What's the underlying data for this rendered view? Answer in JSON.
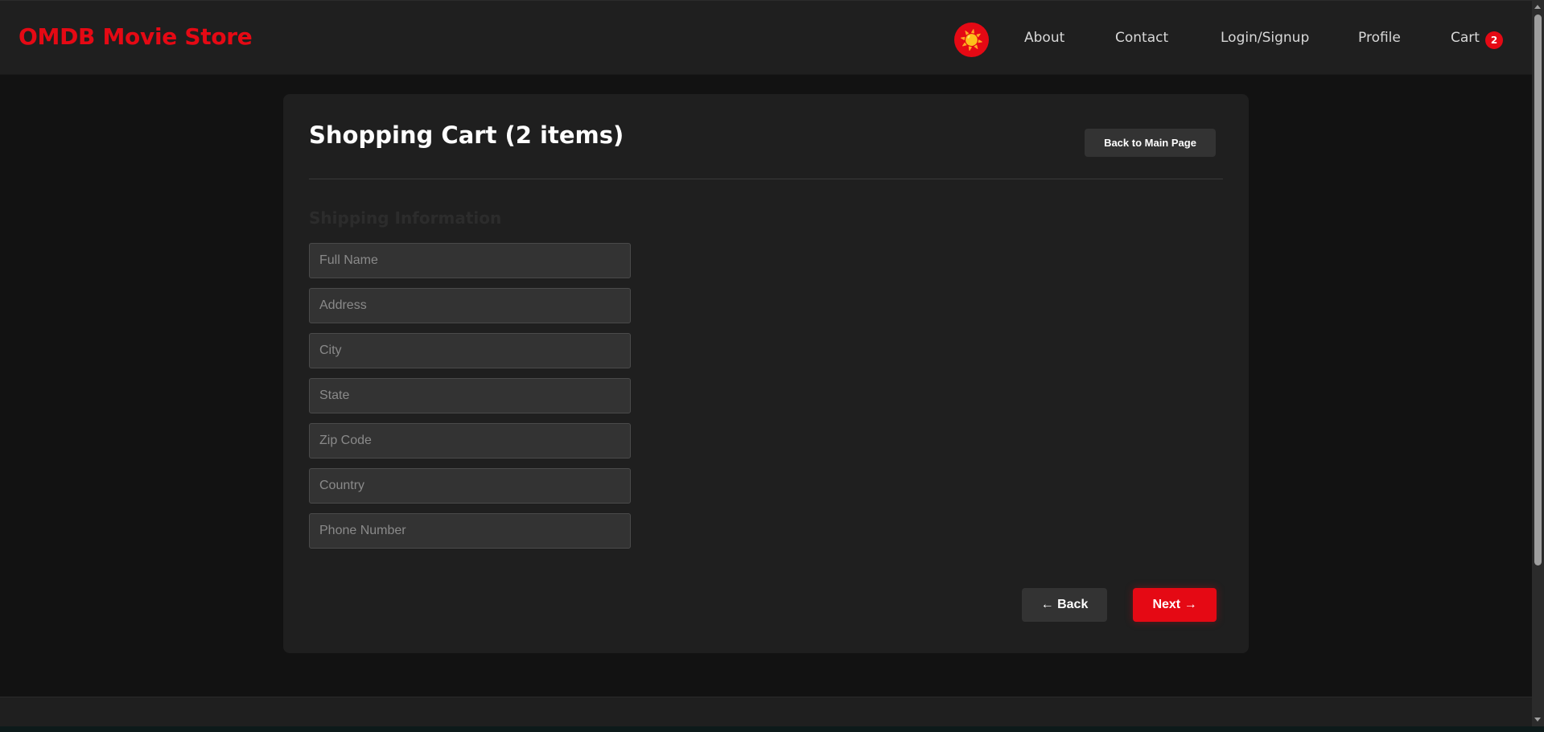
{
  "header": {
    "brand": "OMDB Movie Store",
    "theme_icon": "sun-icon",
    "theme_glyph": "☀️",
    "nav": [
      {
        "label": "About"
      },
      {
        "label": "Contact"
      },
      {
        "label": "Login/Signup"
      },
      {
        "label": "Profile"
      },
      {
        "label": "Cart"
      }
    ],
    "cart_count": "2"
  },
  "cart": {
    "title": "Shopping Cart (2 items)",
    "back_main_label": "Back to Main Page",
    "section_heading": "Shipping Information",
    "fields": [
      {
        "placeholder": "Full Name",
        "value": ""
      },
      {
        "placeholder": "Address",
        "value": ""
      },
      {
        "placeholder": "City",
        "value": ""
      },
      {
        "placeholder": "State",
        "value": ""
      },
      {
        "placeholder": "Zip Code",
        "value": ""
      },
      {
        "placeholder": "Country",
        "value": ""
      },
      {
        "placeholder": "Phone Number",
        "value": ""
      }
    ],
    "back_label": "← Back",
    "next_label": "Next →"
  },
  "colors": {
    "accent": "#e50914",
    "background": "#121212",
    "surface": "#1f1f1f",
    "input_bg": "#333333"
  }
}
